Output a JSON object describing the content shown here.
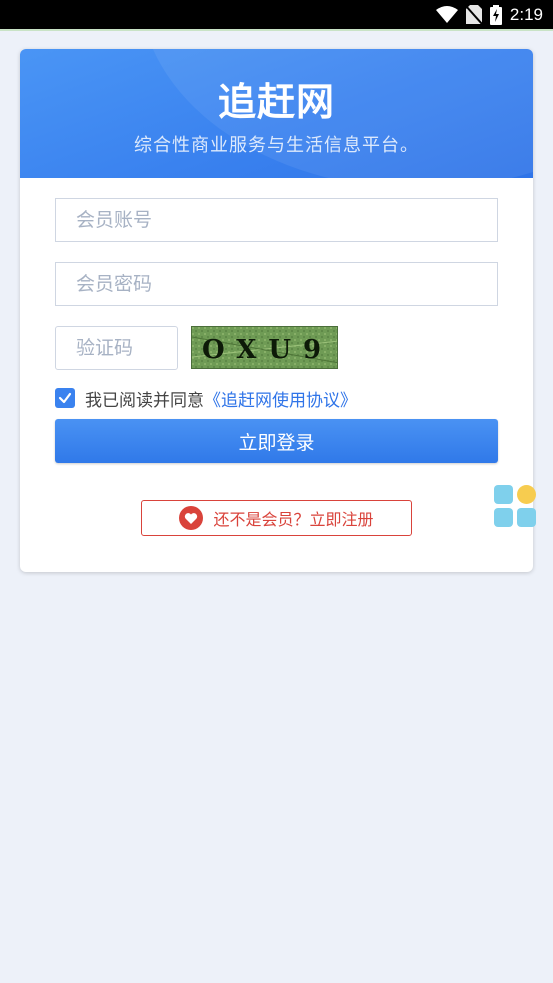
{
  "status_bar": {
    "time": "2:19",
    "icons": [
      "wifi-icon",
      "no-sim-icon",
      "battery-charging-icon"
    ]
  },
  "app": {
    "title": "追赶网",
    "subtitle": "综合性商业服务与生活信息平台。"
  },
  "form": {
    "account_placeholder": "会员账号",
    "password_placeholder": "会员密码",
    "captcha_placeholder": "验证码",
    "captcha_text": "OXU9",
    "agree_text": "我已阅读并同意",
    "agree_link": "《追赶网使用协议》",
    "agree_checked": true,
    "login_label": "立即登录",
    "register_label": "还不是会员？立即注册"
  },
  "colors": {
    "primary": "#3a82ef",
    "danger": "#d9433b",
    "background": "#edf1f9",
    "widget_blue": "#7fd0ec",
    "widget_yellow": "#f7cc4f"
  }
}
